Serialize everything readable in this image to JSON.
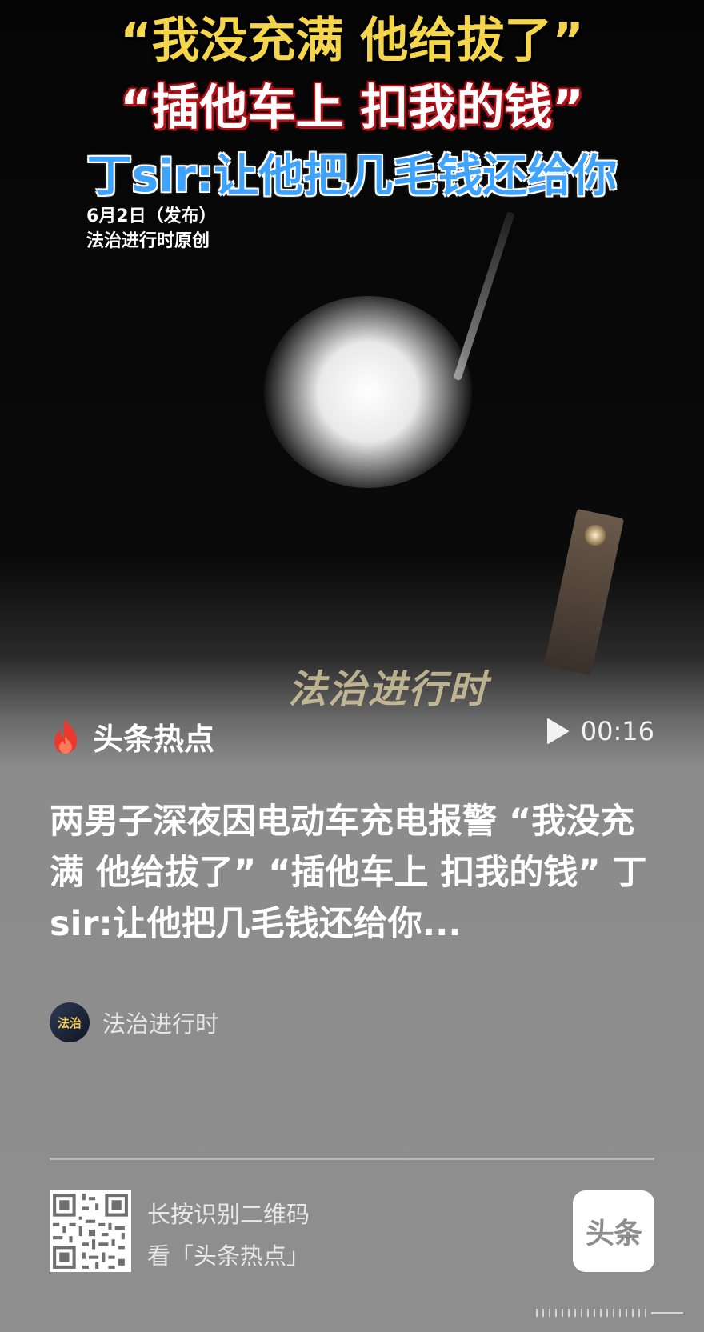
{
  "video": {
    "overlay_line1": "“我没充满 他给拔了”",
    "overlay_line2": "“插他车上 扣我的钱”",
    "overlay_line3": "丁sir:让他把几毛钱还给你",
    "date": "6月2日（发布）",
    "source": "法治进行时原创",
    "watermark": "法治进行时",
    "duration": "00:16",
    "play_icon": "play-icon"
  },
  "brand": {
    "name": "头条热点",
    "icon": "fire-icon",
    "color": "#e8392c"
  },
  "article": {
    "headline": "两男子深夜因电动车充电报警 “我没充满 他给拔了” “插他车上 扣我的钱” 丁sir:让他把几毛钱还给你...",
    "author": "法治进行时",
    "avatar_text": "法治"
  },
  "footer": {
    "qr_hint_line1": "长按识别二维码",
    "qr_hint_line2": "看「头条热点」",
    "app_logo_text": "头条"
  }
}
